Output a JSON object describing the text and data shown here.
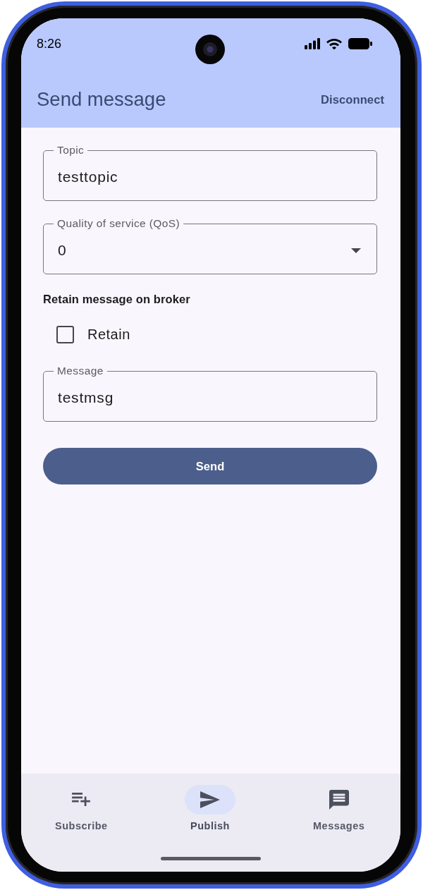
{
  "status_bar": {
    "time": "8:26"
  },
  "app_bar": {
    "title": "Send message",
    "action": "Disconnect"
  },
  "form": {
    "topic": {
      "label": "Topic",
      "value": "testtopic"
    },
    "qos": {
      "label": "Quality of service (QoS)",
      "value": "0"
    },
    "retain": {
      "heading": "Retain message on broker",
      "label": "Retain",
      "checked": false
    },
    "message": {
      "label": "Message",
      "value": "testmsg"
    },
    "send_button": "Send"
  },
  "bottom_nav": [
    {
      "kind": "subscribe",
      "label": "Subscribe",
      "selected": false
    },
    {
      "kind": "publish",
      "label": "Publish",
      "selected": true
    },
    {
      "kind": "messages",
      "label": "Messages",
      "selected": false
    }
  ]
}
